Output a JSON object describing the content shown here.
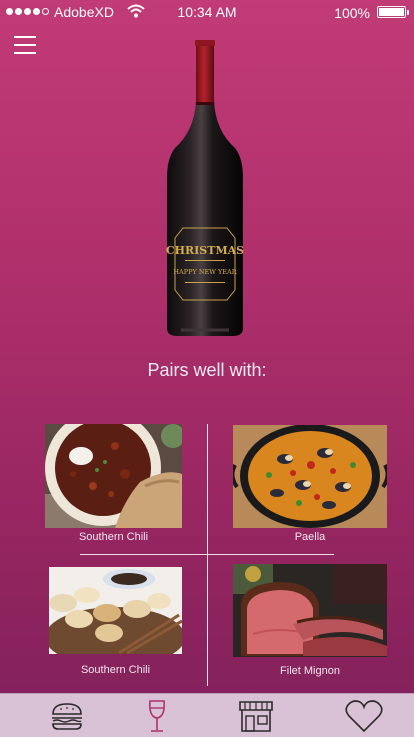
{
  "status_bar": {
    "carrier": "AdobeXD",
    "time": "10:34 AM",
    "battery": "100%"
  },
  "bottle": {
    "label_line1": "CHRISTMAS",
    "label_line2": "HAPPY NEW YEAR"
  },
  "pairs_title": "Pairs well with:",
  "pairings": [
    {
      "label": "Southern Chili",
      "icon": "chili-photo"
    },
    {
      "label": "Paella",
      "icon": "paella-photo"
    },
    {
      "label": "Southern Chili",
      "icon": "dumplings-photo"
    },
    {
      "label": "Filet Mignon",
      "icon": "filet-mignon-photo"
    }
  ],
  "tab_bar": {
    "items": [
      "burger-icon",
      "wine-glass-icon",
      "store-icon",
      "heart-icon"
    ],
    "active": "wine-glass-icon",
    "active_color": "#b0306c",
    "inactive_color": "#2a2a2a"
  }
}
